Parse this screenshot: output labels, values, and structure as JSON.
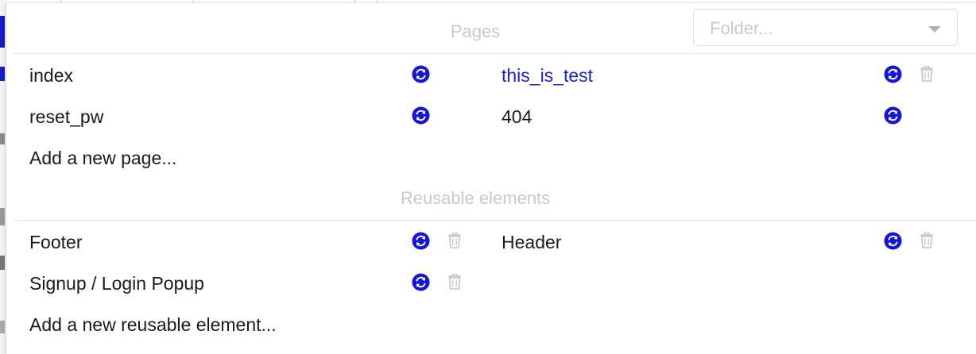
{
  "pages_section": {
    "title": "Pages",
    "folder_placeholder": "Folder...",
    "items": [
      {
        "name": "index"
      },
      {
        "name": "this_is_test"
      },
      {
        "name": "reset_pw"
      },
      {
        "name": "404"
      }
    ],
    "add_label": "Add a new page..."
  },
  "reusable_section": {
    "title": "Reusable elements",
    "items": [
      {
        "name": "Footer"
      },
      {
        "name": "Header"
      },
      {
        "name": "Signup / Login Popup"
      }
    ],
    "add_label": "Add a new reusable element..."
  },
  "icons": {
    "sync": "sync-circle-icon",
    "delete": "trash-icon",
    "caret": "chevron-down-icon"
  },
  "colors": {
    "accent": "#1515d6",
    "link": "#1f1fcf",
    "muted_text": "#c8c8c8",
    "divider": "#e3e3e3",
    "trash": "#c4c4c4"
  }
}
